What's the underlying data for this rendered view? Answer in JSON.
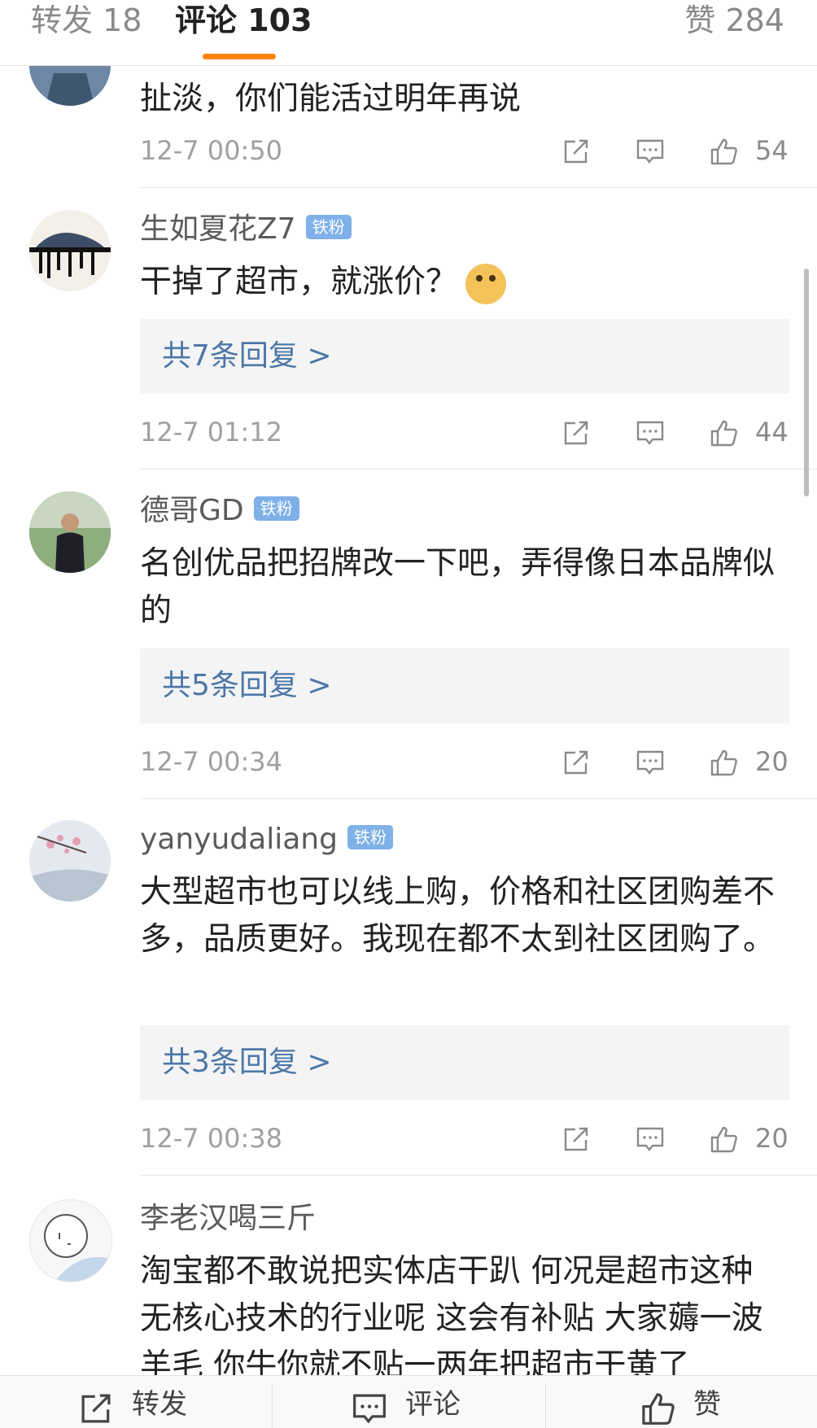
{
  "tabs": {
    "repost": "转发 18",
    "comment": "评论 103",
    "like": "赞 284"
  },
  "comments": [
    {
      "content": "扯淡，你们能活过明年再说",
      "time": "12-7 00:50",
      "likes": "54"
    },
    {
      "username": "生如夏花Z7",
      "badge": "铁粉",
      "content": "干掉了超市，就涨价？",
      "replies": "共7条回复 >",
      "time": "12-7 01:12",
      "likes": "44"
    },
    {
      "username": "德哥GD",
      "badge": "铁粉",
      "content": "名创优品把招牌改一下吧，弄得像日本品牌似的",
      "replies": "共5条回复 >",
      "time": "12-7 00:34",
      "likes": "20"
    },
    {
      "username": "yanyudaliang",
      "badge": "铁粉",
      "content": "大型超市也可以线上购，价格和社区团购差不多，品质更好。我现在都不太到社区团购了。",
      "replies": "共3条回复 >",
      "time": "12-7 00:38",
      "likes": "20"
    },
    {
      "username": "李老汉喝三斤",
      "content": "淘宝都不敢说把实体店干趴 何况是超市这种无核心技术的行业呢 这会有补贴 大家薅一波羊毛 你牛你就不贴一两年把超市干黄了"
    }
  ],
  "bottom_bar": {
    "repost": "转发",
    "comment": "评论",
    "like": "赞"
  },
  "colors": {
    "accent": "#ff8200",
    "link": "#4d77a8",
    "badge": "#7fb0e8"
  }
}
